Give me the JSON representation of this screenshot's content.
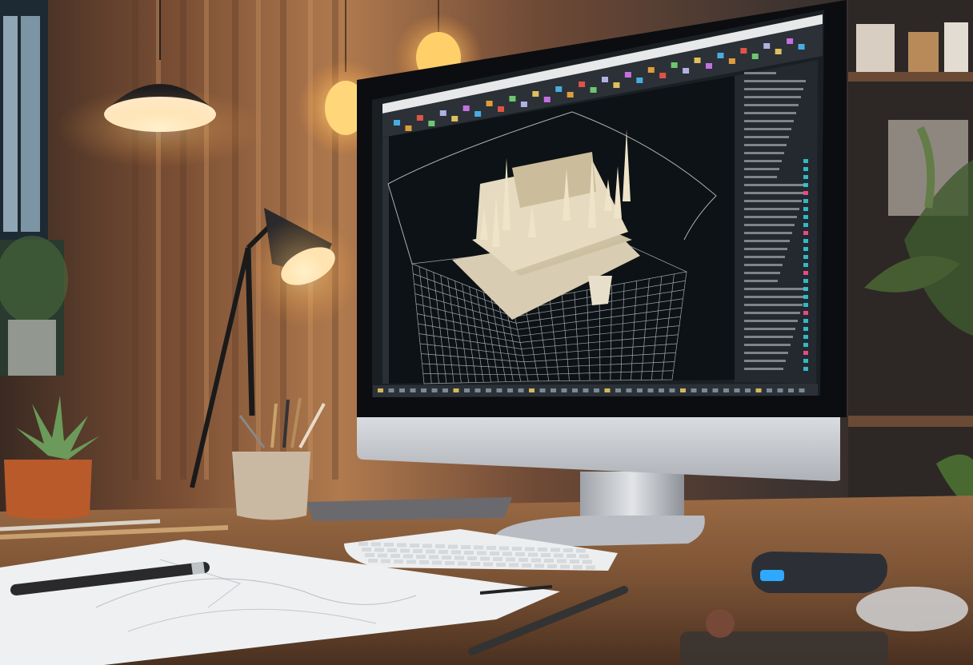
{
  "scene": {
    "description_free": true
  },
  "cad_app": {
    "toolbar_icon_colors": [
      "#4cc3ff",
      "#ffb03a",
      "#ff5b4a",
      "#7be07b",
      "#c9c9ff",
      "#ffd966",
      "#e07bff"
    ],
    "viewport_background": "#0d1216",
    "model_color": "#e8dcc0",
    "wireframe_color": "#cfd6da",
    "panel_background": "#23292e",
    "accent_teal": "#35c8d8",
    "accent_pink": "#ff4d8f"
  },
  "palette": {
    "wall_warm": "#a8734a",
    "wood_desk": "#8a5a36",
    "lamp_glow": "#ffe2a6",
    "monitor_silver": "#c8cbd0",
    "plant_pot": "#b85a2a"
  }
}
